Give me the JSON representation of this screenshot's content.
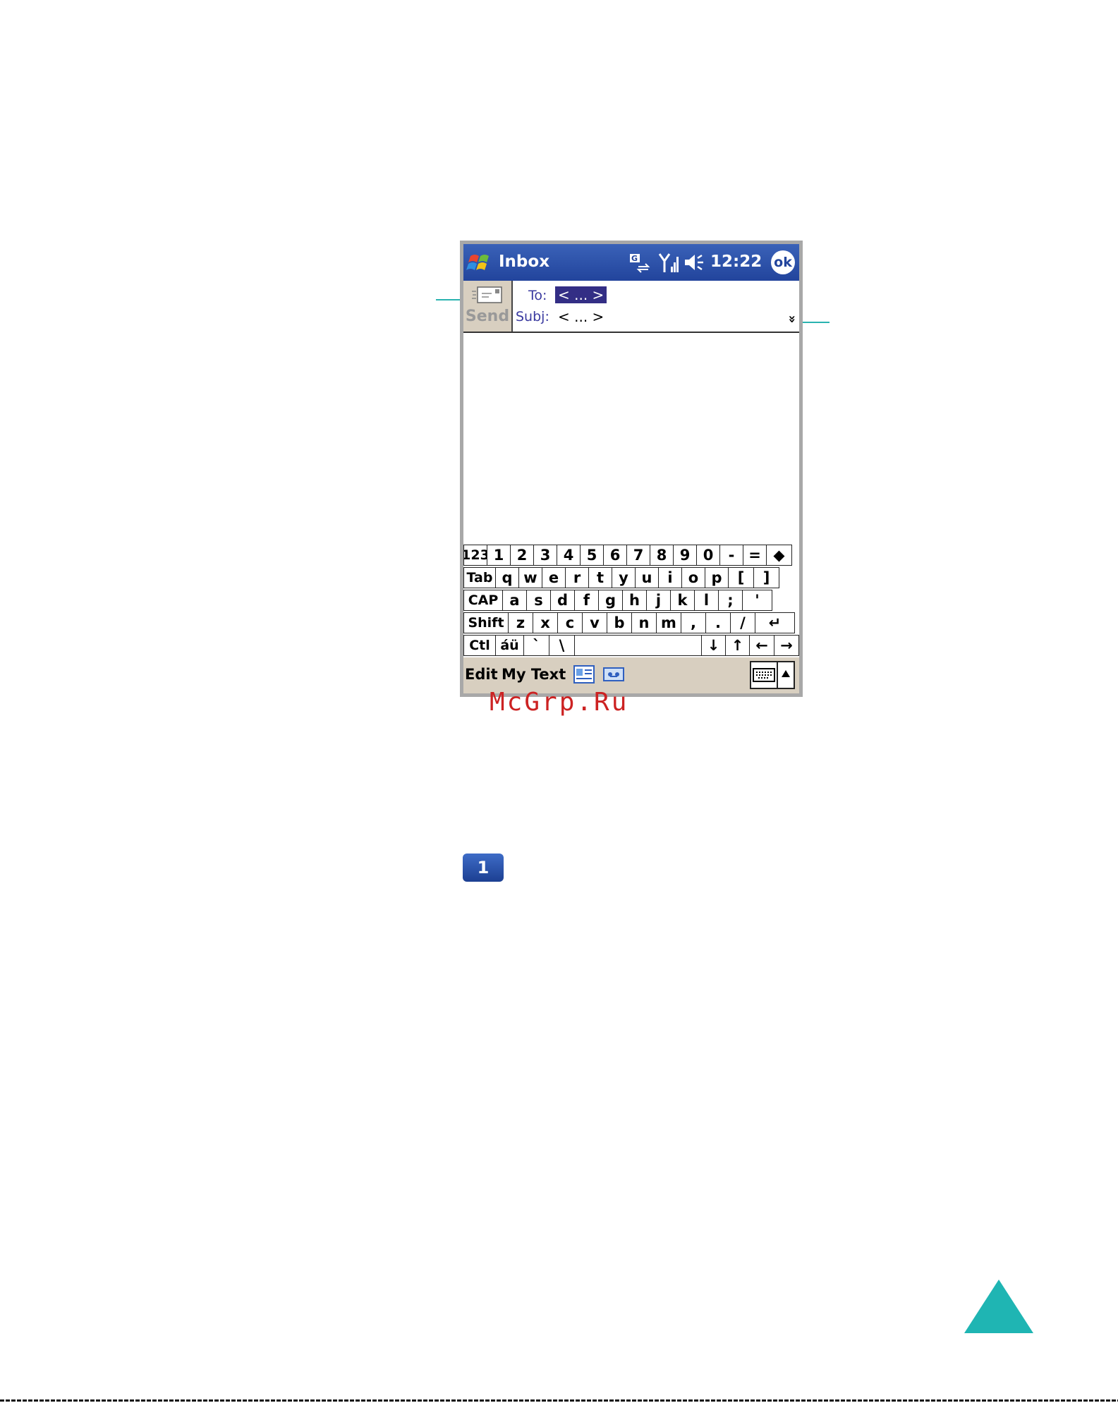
{
  "titlebar": {
    "title": "Inbox",
    "time": "12:22",
    "ok_label": "ok"
  },
  "header": {
    "send_label": "Send",
    "to_label": "To:",
    "to_value": "< ... >",
    "subj_label": "Subj:",
    "subj_value": "< ... >",
    "expand_glyph": "»"
  },
  "keyboard": {
    "rows": [
      [
        "123",
        "1",
        "2",
        "3",
        "4",
        "5",
        "6",
        "7",
        "8",
        "9",
        "0",
        "-",
        "=",
        "◆"
      ],
      [
        "Tab",
        "q",
        "w",
        "e",
        "r",
        "t",
        "y",
        "u",
        "i",
        "o",
        "p",
        "[",
        "]"
      ],
      [
        "CAP",
        "a",
        "s",
        "d",
        "f",
        "g",
        "h",
        "j",
        "k",
        "l",
        ";",
        "'"
      ],
      [
        "Shift",
        "z",
        "x",
        "c",
        "v",
        "b",
        "n",
        "m",
        ",",
        ".",
        "/",
        "↵"
      ],
      [
        "Ctl",
        "áü",
        "`",
        "\\",
        " ",
        "↓",
        "↑",
        "←",
        "→"
      ]
    ]
  },
  "menubar": {
    "edit_label": "Edit",
    "mytext_label": "My Text"
  },
  "watermark": "McGrp.Ru",
  "step_badge": "1",
  "colors": {
    "titlebar": "#22449c",
    "accent": "#1fb5b3",
    "selection": "#332e85"
  }
}
